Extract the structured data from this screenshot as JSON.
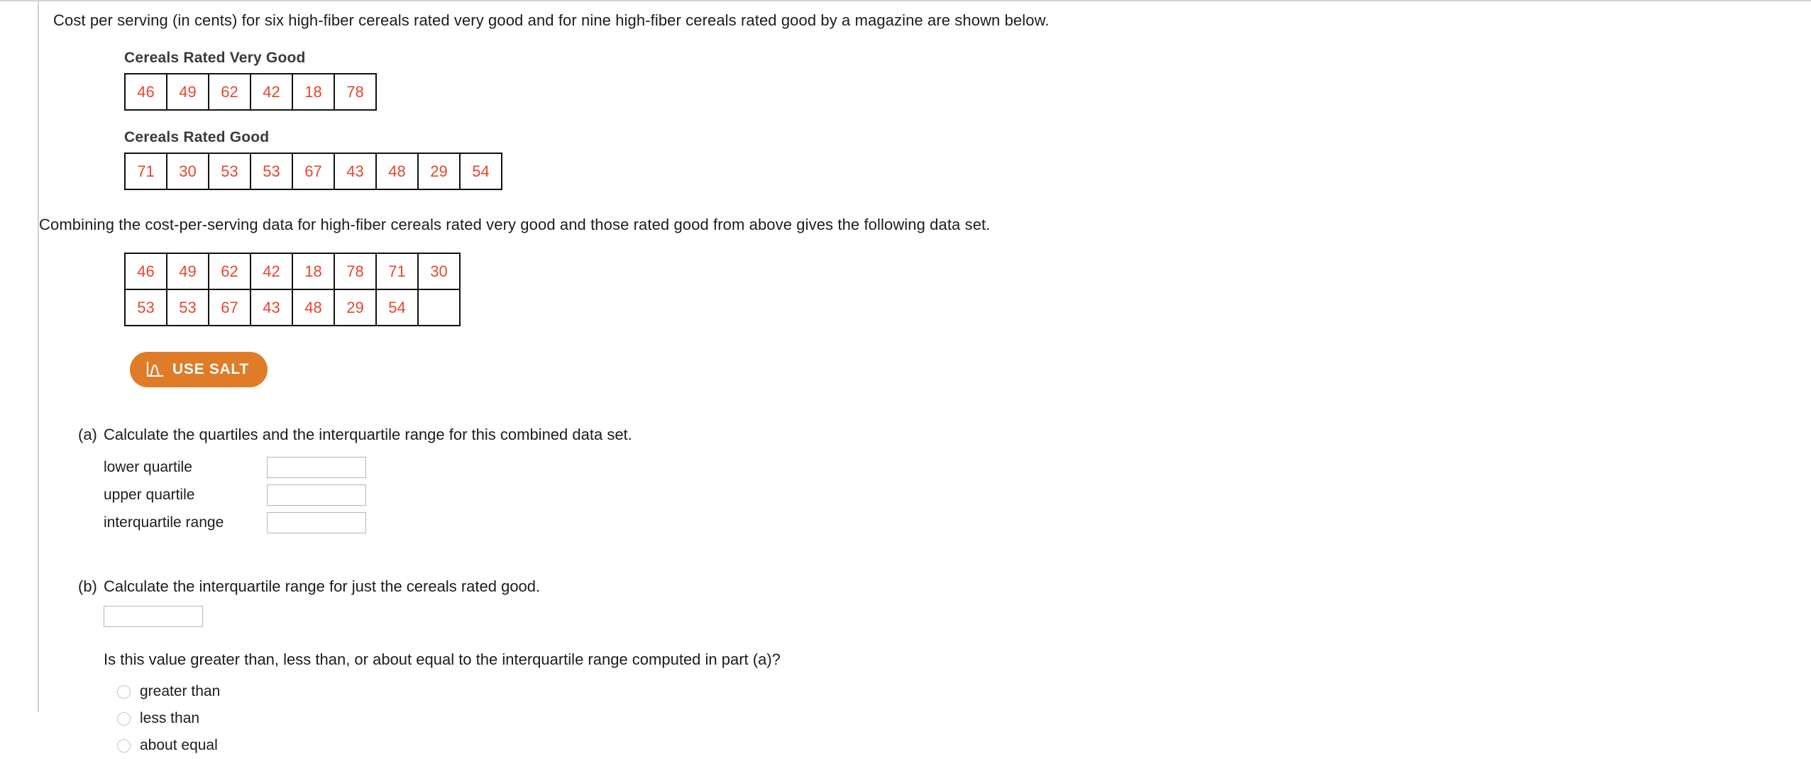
{
  "intro": {
    "text": "Cost per serving (in cents) for six high-fiber cereals rated very good and for nine high-fiber cereals rated good by a magazine are shown below."
  },
  "tables": {
    "very_good": {
      "caption": "Cereals Rated Very Good",
      "rows": [
        [
          "46",
          "49",
          "62",
          "42",
          "18",
          "78"
        ]
      ]
    },
    "good": {
      "caption": "Cereals Rated Good",
      "rows": [
        [
          "71",
          "30",
          "53",
          "53",
          "67",
          "43",
          "48",
          "29",
          "54"
        ]
      ]
    },
    "combined": {
      "rows": [
        [
          "46",
          "49",
          "62",
          "42",
          "18",
          "78",
          "71",
          "30"
        ],
        [
          "53",
          "53",
          "67",
          "43",
          "48",
          "29",
          "54",
          ""
        ]
      ]
    }
  },
  "combining_text": "Combining the cost-per-serving data for high-fiber cereals rated very good and those rated good from above gives the following data set.",
  "salt": {
    "label": "USE SALT",
    "icon": "distribution-curve-icon",
    "background_color": "#e07b27",
    "text_color": "#ffffff"
  },
  "part_a": {
    "marker": "(a)",
    "prompt": "Calculate the quartiles and the interquartile range for this combined data set.",
    "fields": [
      {
        "label": "lower quartile",
        "value": "",
        "placeholder": ""
      },
      {
        "label": "upper quartile",
        "value": "",
        "placeholder": ""
      },
      {
        "label": "interquartile range",
        "value": "",
        "placeholder": ""
      }
    ]
  },
  "part_b": {
    "marker": "(b)",
    "prompt": "Calculate the interquartile range for just the cereals rated good.",
    "field": {
      "value": "",
      "placeholder": ""
    },
    "followup": "Is this value greater than, less than, or about equal to the interquartile range computed in part (a)?",
    "options": [
      {
        "label": "greater than",
        "selected": false
      },
      {
        "label": "less than",
        "selected": false
      },
      {
        "label": "about equal",
        "selected": false
      }
    ]
  },
  "colors": {
    "data_value": "#e8462c",
    "caption": "#3a3a3a",
    "border": "#111111",
    "input_border": "#b6b6b6"
  }
}
